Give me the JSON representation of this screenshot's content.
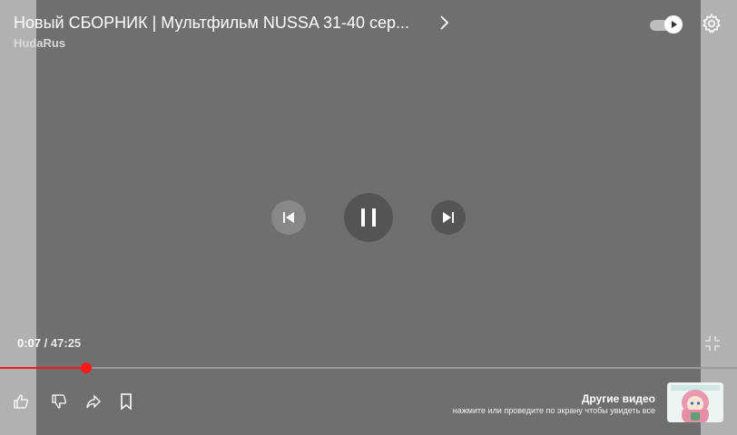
{
  "video": {
    "title": "Новый СБОРНИК | Мультфильм NUSSA 31-40 сер...",
    "channel": "HudaRus"
  },
  "playback": {
    "current_time": "0:07",
    "separator": "/",
    "duration": "47:25",
    "progress_fraction": 0.117,
    "state": "playing",
    "autoplay": true
  },
  "suggestions": {
    "title": "Другие видео",
    "subtitle": "нажмите или проведите по экрану чтобы увидеть все"
  },
  "colors": {
    "progress": "#ff1a1a",
    "overlay": "#6f6f6f"
  },
  "icons": {
    "next_title": "chevron-right-icon",
    "autoplay": "autoplay-toggle-icon",
    "settings": "gear-icon",
    "previous": "previous-icon",
    "pause": "pause-icon",
    "next": "next-icon",
    "exit_fullscreen": "exit-fullscreen-icon",
    "like": "thumbs-up-icon",
    "dislike": "thumbs-down-icon",
    "share": "share-icon",
    "save": "bookmark-icon"
  }
}
